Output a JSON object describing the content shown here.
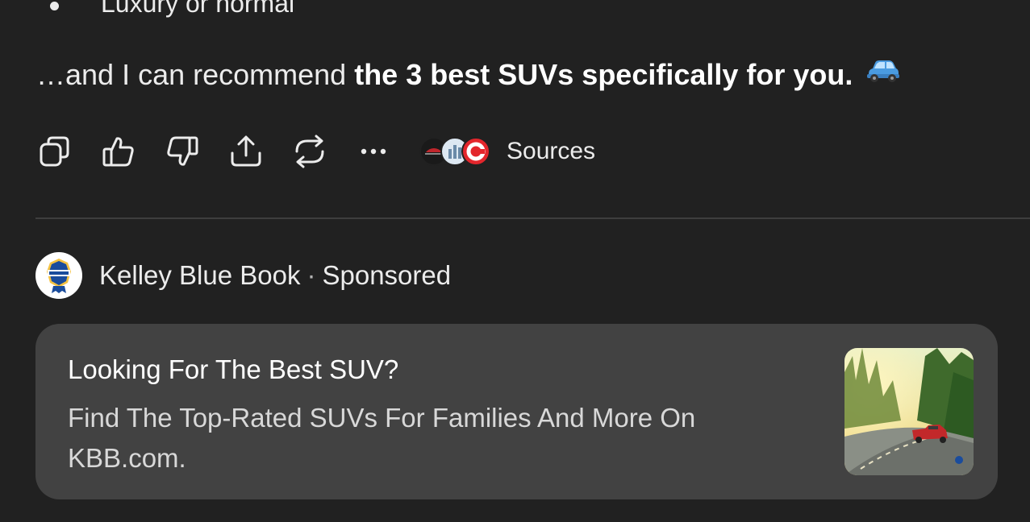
{
  "bullet": {
    "text": "Luxury or normal"
  },
  "message": {
    "prefix": "…and I can recommend ",
    "bold": "the 3 best SUVs specifically for you.",
    "emoji_icon": "car-emoji-icon"
  },
  "actions": {
    "buttons": [
      {
        "name": "copy-icon"
      },
      {
        "name": "thumbs-up-icon"
      },
      {
        "name": "thumbs-down-icon"
      },
      {
        "name": "share-icon"
      },
      {
        "name": "regenerate-icon"
      },
      {
        "name": "more-icon"
      }
    ],
    "sources_label": "Sources",
    "source_favicons": [
      "newest-cars-favicon",
      "chart-site-favicon",
      "c-site-favicon"
    ]
  },
  "sponsor": {
    "name": "Kelley Blue Book",
    "separator": "·",
    "tag": "Sponsored",
    "logo_icon": "kbb-logo"
  },
  "ad": {
    "title": "Looking For The Best SUV?",
    "description": "Find The Top-Rated SUVs For Families And More On KBB.com.",
    "image": "suv-on-forest-road-photo"
  },
  "colors": {
    "background": "#212121",
    "card": "#424242",
    "text": "#ececec",
    "divider": "#3e3e3e"
  }
}
